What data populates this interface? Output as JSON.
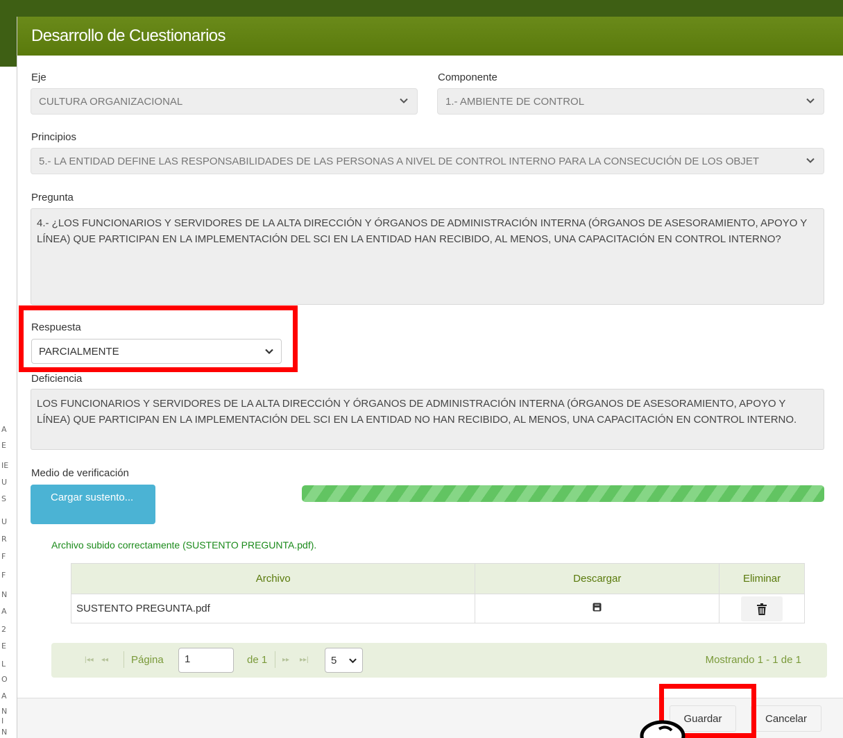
{
  "modal": {
    "title": "Desarrollo de Cuestionarios"
  },
  "form": {
    "eje_label": "Eje",
    "eje_value": "CULTURA ORGANIZACIONAL",
    "componente_label": "Componente",
    "componente_value": "1.- AMBIENTE DE CONTROL",
    "principios_label": "Principios",
    "principios_value": "5.- LA ENTIDAD DEFINE LAS RESPONSABILIDADES DE LAS PERSONAS A NIVEL DE CONTROL INTERNO PARA LA CONSECUCIÓN DE LOS OBJET",
    "pregunta_label": "Pregunta",
    "pregunta_value": "4.- ¿LOS FUNCIONARIOS Y SERVIDORES DE LA ALTA DIRECCIÓN Y ÓRGANOS DE ADMINISTRACIÓN INTERNA (ÓRGANOS DE ASESORAMIENTO, APOYO Y LÍNEA) QUE PARTICIPAN EN LA IMPLEMENTACIÓN DEL SCI EN LA ENTIDAD HAN RECIBIDO, AL MENOS, UNA CAPACITACIÓN EN CONTROL INTERNO?",
    "respuesta_label": "Respuesta",
    "respuesta_value": "PARCIALMENTE",
    "deficiencia_label": "Deficiencia",
    "deficiencia_value": "LOS FUNCIONARIOS Y SERVIDORES DE LA ALTA DIRECCIÓN Y ÓRGANOS DE ADMINISTRACIÓN INTERNA (ÓRGANOS DE ASESORAMIENTO, APOYO Y LÍNEA) QUE PARTICIPAN EN LA IMPLEMENTACIÓN DEL SCI EN LA ENTIDAD NO HAN RECIBIDO, AL MENOS, UNA CAPACITACIÓN EN CONTROL INTERNO.",
    "medio_label": "Medio de verificación"
  },
  "upload": {
    "button_label": "Cargar sustento...",
    "progress": 1.0,
    "success_message": "Archivo subido correctamente (SUSTENTO PREGUNTA.pdf)."
  },
  "table": {
    "headers": {
      "archivo": "Archivo",
      "descargar": "Descargar",
      "eliminar": "Eliminar"
    },
    "rows": [
      {
        "archivo": "SUSTENTO PREGUNTA.pdf"
      }
    ]
  },
  "pager": {
    "page_label": "Página",
    "page_value": "1",
    "of_label": "de 1",
    "page_size": "5",
    "summary": "Mostrando 1 - 1 de 1"
  },
  "footer": {
    "save_label": "Guardar",
    "cancel_label": "Cancelar"
  },
  "colors": {
    "header": "#5f7f11",
    "highlight": "#ff0000",
    "upload_button": "#4bb3d4",
    "progress": "#62c462"
  },
  "background_fragments": [
    "A",
    "E",
    "IE",
    "U",
    "S",
    "U",
    "R",
    "F",
    "F",
    "N",
    "A",
    "2",
    "E",
    "L",
    "O",
    "A",
    "N",
    "I",
    "N"
  ]
}
